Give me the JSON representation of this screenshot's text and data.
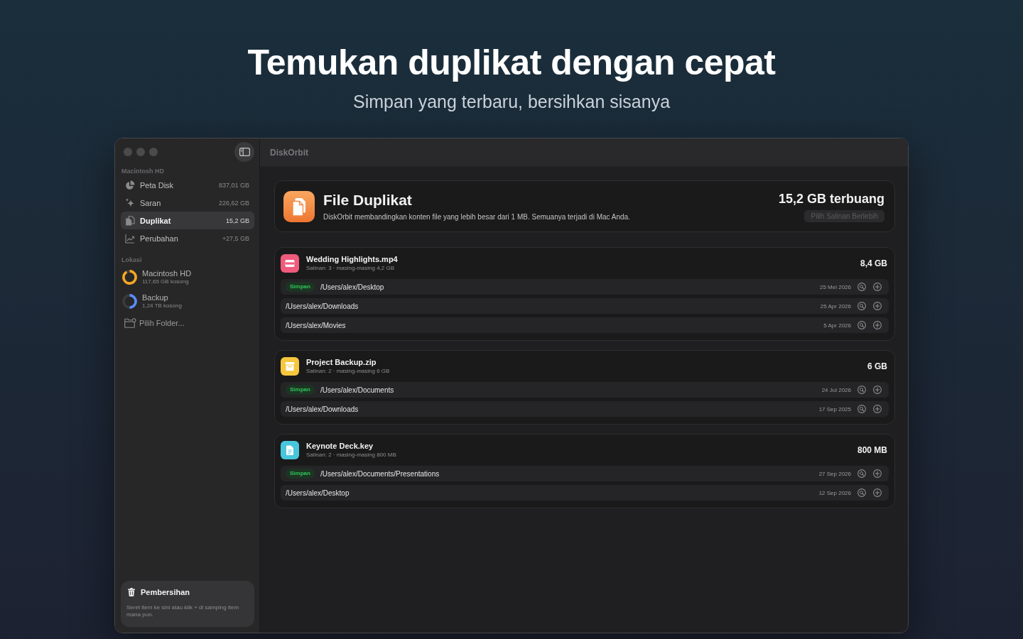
{
  "hero": {
    "title": "Temukan duplikat dengan cepat",
    "subtitle": "Simpan yang terbaru, bersihkan sisanya"
  },
  "window": {
    "title": "DiskOrbit"
  },
  "sidebar": {
    "disk": {
      "title": "Macintosh HD",
      "items": [
        {
          "label": "Peta Disk",
          "value": "837,01 GB",
          "selected": false
        },
        {
          "label": "Saran",
          "value": "226,62 GB",
          "selected": false
        },
        {
          "label": "Duplikat",
          "value": "15,2 GB",
          "selected": true
        },
        {
          "label": "Perubahan",
          "value": "+27,5 GB",
          "selected": false
        }
      ]
    },
    "locations": {
      "title": "Lokasi",
      "items": [
        {
          "name": "Macintosh HD",
          "free": "117,65 GB kosong",
          "level": 0.92,
          "color": "#f5a623"
        },
        {
          "name": "Backup",
          "free": "1,24 TB kosong",
          "level": 0.5,
          "color": "#5b8cff"
        }
      ],
      "pick_folder": "Pilih Folder..."
    },
    "cleanup": {
      "title": "Pembersihan",
      "text": "Seret item ke sini atau klik + di samping item mana pun."
    }
  },
  "header": {
    "title": "File Duplikat",
    "description": "DiskOrbit membandingkan konten file yang lebih besar dari 1 MB. Semuanya terjadi di Mac Anda.",
    "total": "15,2 GB terbuang",
    "button": {
      "label": "Pilih Salinan Berlebih",
      "disabled": true
    }
  },
  "groups": [
    {
      "name": "Wedding Highlights.mp4",
      "summary": "Salinan: 3 · masing-masing 4,2 GB",
      "size": "8,4 GB",
      "color": "#ef5b7d",
      "copies": [
        {
          "badge": "Simpan",
          "path": "/Users/alex/Desktop",
          "date": "25 Mei 2026"
        },
        {
          "path": "/Users/alex/Downloads",
          "date": "25 Apr 2026"
        },
        {
          "path": "/Users/alex/Movies",
          "date": "5 Apr 2026"
        }
      ]
    },
    {
      "name": "Project Backup.zip",
      "summary": "Salinan: 2 · masing-masing 6 GB",
      "size": "6 GB",
      "color": "#f5c73d",
      "copies": [
        {
          "badge": "Simpan",
          "path": "/Users/alex/Documents",
          "date": "24 Jul 2026"
        },
        {
          "path": "/Users/alex/Downloads",
          "date": "17 Sep 2025"
        }
      ]
    },
    {
      "name": "Keynote Deck.key",
      "summary": "Salinan: 2 · masing-masing 800 MB",
      "size": "800 MB",
      "color": "#48c6dc",
      "copies": [
        {
          "badge": "Simpan",
          "path": "/Users/alex/Documents/Presentations",
          "date": "27 Sep 2026"
        },
        {
          "path": "/Users/alex/Desktop",
          "date": "12 Sep 2026"
        }
      ]
    }
  ]
}
